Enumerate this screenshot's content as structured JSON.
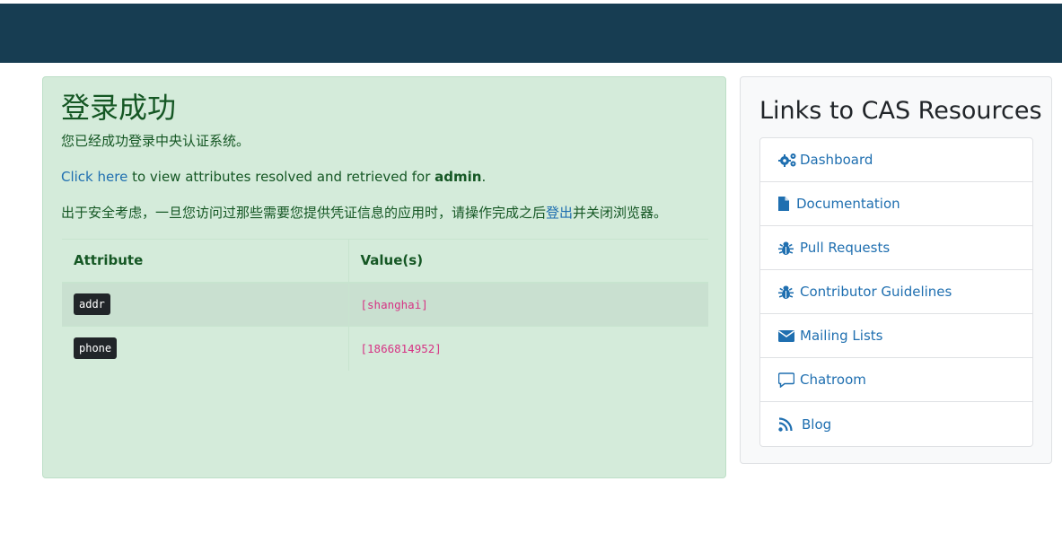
{
  "success": {
    "title": "登录成功",
    "message": "您已经成功登录中央认证系统。",
    "attributes_link": "Click here",
    "attributes_text": " to view attributes resolved and retrieved for ",
    "username": "admin",
    "attributes_end": ".",
    "security_text": "出于安全考虑，一旦您访问过那些需要您提供凭证信息的应用时，请操作完成之后",
    "logout_link": "登出",
    "security_end": "并关闭浏览器。",
    "table": {
      "headers": [
        "Attribute",
        "Value(s)"
      ],
      "rows": [
        {
          "attribute": "addr",
          "value": "[shanghai]"
        },
        {
          "attribute": "phone",
          "value": "[1866814952]"
        }
      ]
    }
  },
  "resources": {
    "title": "Links to CAS Resources",
    "items": [
      {
        "label": "Dashboard",
        "icon": "cogs-icon"
      },
      {
        "label": "Documentation",
        "icon": "file-icon"
      },
      {
        "label": "Pull Requests",
        "icon": "bug-icon"
      },
      {
        "label": "Contributor Guidelines",
        "icon": "bug-icon"
      },
      {
        "label": "Mailing Lists",
        "icon": "envelope-icon"
      },
      {
        "label": "Chatroom",
        "icon": "comment-icon"
      },
      {
        "label": "Blog",
        "icon": "rss-icon"
      }
    ]
  },
  "colors": {
    "header": "#173d52",
    "success_bg": "#d4ebda",
    "success_text": "#155724",
    "link": "#1f6fb0",
    "code": "#d63384"
  }
}
